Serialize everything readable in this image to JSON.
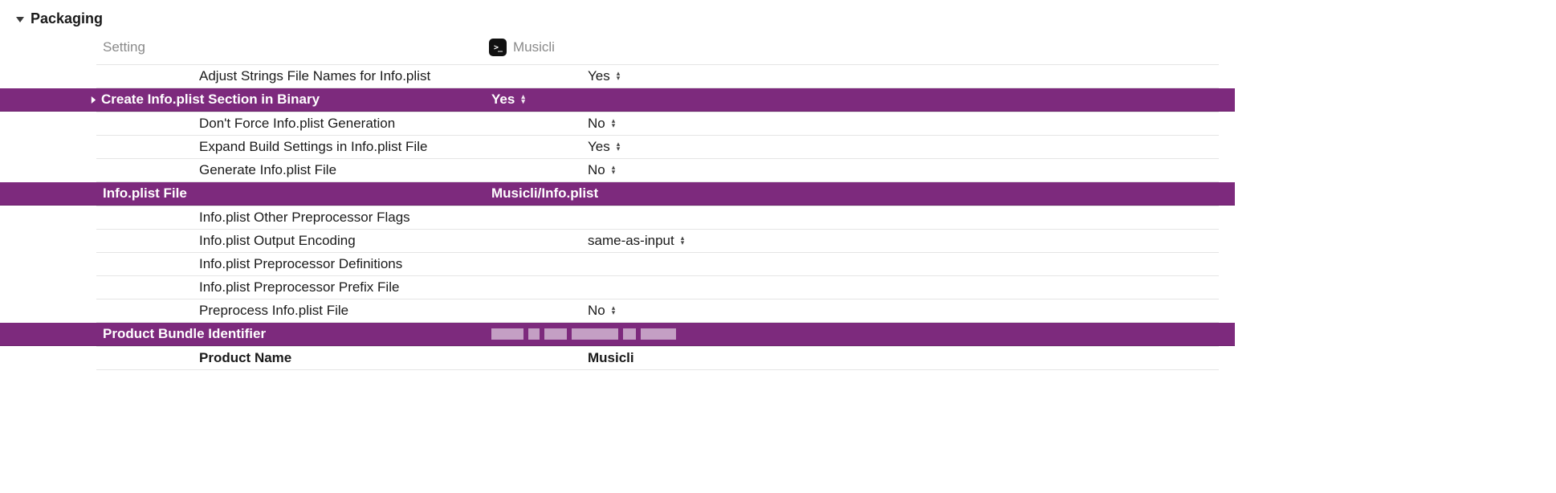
{
  "section": {
    "title": "Packaging"
  },
  "columns": {
    "setting": "Setting",
    "target": "Musicli"
  },
  "rows": [
    {
      "label": "Adjust Strings File Names for Info.plist",
      "value": "Yes",
      "dropdown": true,
      "highlight": false,
      "expandable": false,
      "bold": false
    },
    {
      "label": "Create Info.plist Section in Binary",
      "value": "Yes",
      "dropdown": true,
      "highlight": true,
      "expandable": true,
      "bold": true
    },
    {
      "label": "Don't Force Info.plist Generation",
      "value": "No",
      "dropdown": true,
      "highlight": false,
      "expandable": false,
      "bold": false
    },
    {
      "label": "Expand Build Settings in Info.plist File",
      "value": "Yes",
      "dropdown": true,
      "highlight": false,
      "expandable": false,
      "bold": false
    },
    {
      "label": "Generate Info.plist File",
      "value": "No",
      "dropdown": true,
      "highlight": false,
      "expandable": false,
      "bold": false
    },
    {
      "label": "Info.plist File",
      "value": "Musicli/Info.plist",
      "dropdown": false,
      "highlight": true,
      "expandable": false,
      "bold": true
    },
    {
      "label": "Info.plist Other Preprocessor Flags",
      "value": "",
      "dropdown": false,
      "highlight": false,
      "expandable": false,
      "bold": false
    },
    {
      "label": "Info.plist Output Encoding",
      "value": "same-as-input",
      "dropdown": true,
      "highlight": false,
      "expandable": false,
      "bold": false
    },
    {
      "label": "Info.plist Preprocessor Definitions",
      "value": "",
      "dropdown": false,
      "highlight": false,
      "expandable": false,
      "bold": false
    },
    {
      "label": "Info.plist Preprocessor Prefix File",
      "value": "",
      "dropdown": false,
      "highlight": false,
      "expandable": false,
      "bold": false
    },
    {
      "label": "Preprocess Info.plist File",
      "value": "No",
      "dropdown": true,
      "highlight": false,
      "expandable": false,
      "bold": false
    },
    {
      "label": "Product Bundle Identifier",
      "value": "",
      "dropdown": false,
      "highlight": true,
      "expandable": false,
      "bold": true,
      "redacted": true
    },
    {
      "label": "Product Name",
      "value": "Musicli",
      "dropdown": false,
      "highlight": false,
      "expandable": false,
      "bold": true
    }
  ]
}
